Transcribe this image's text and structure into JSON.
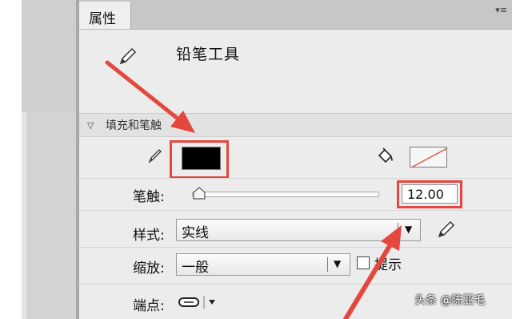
{
  "panel": {
    "tab_label": "属性",
    "menu_icon": "panel-menu-icon",
    "tool_name": "铅笔工具",
    "section_title": "填充和笔触"
  },
  "colors": {
    "stroke_color": "#000000",
    "highlight": "#e4473d"
  },
  "stroke": {
    "label": "笔触:",
    "value": "12.00",
    "slider_level": 0.04
  },
  "style": {
    "label": "样式:",
    "value": "实线"
  },
  "scale": {
    "label": "缩放:",
    "value": "一般",
    "hint_label": "提示"
  },
  "cap": {
    "label": "端点:"
  },
  "watermark": {
    "text": "头条 @陈亚毛"
  }
}
